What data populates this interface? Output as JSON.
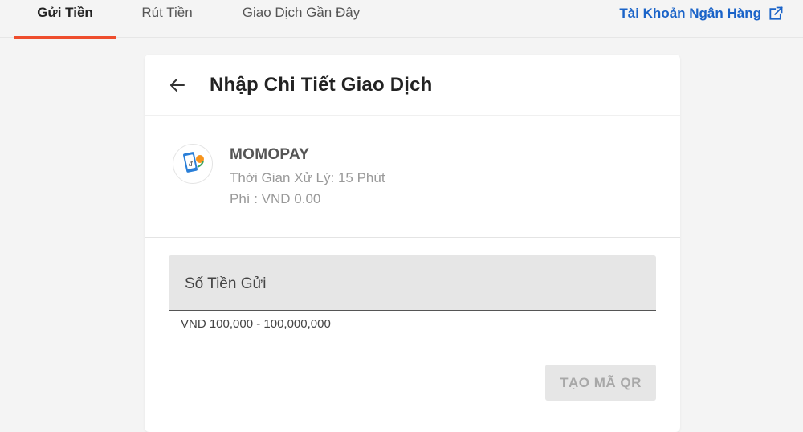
{
  "tabs": {
    "deposit": "Gửi Tiền",
    "withdraw": "Rút Tiền",
    "recent": "Giao Dịch Gần Đây"
  },
  "bank_link": {
    "label": "Tài Khoản Ngân Hàng",
    "icon": "external-link-icon"
  },
  "card": {
    "title": "Nhập Chi Tiết Giao Dịch",
    "back_icon": "arrow-left-icon"
  },
  "method": {
    "name": "MOMOPAY",
    "processing_time": "Thời Gian Xử Lý: 15 Phút",
    "fee": "Phí : VND 0.00",
    "logo_icon": "momopay-logo-icon"
  },
  "amount": {
    "placeholder": "Số Tiền Gửi",
    "value": "",
    "range_hint": "VND 100,000 - 100,000,000"
  },
  "qr_button": {
    "label": "TẠO MÃ QR",
    "enabled": false
  },
  "colors": {
    "accent": "#ee4d2d",
    "link": "#1a63c8",
    "disabled_bg": "#e6e6e6",
    "disabled_text": "#a8a8a8"
  }
}
